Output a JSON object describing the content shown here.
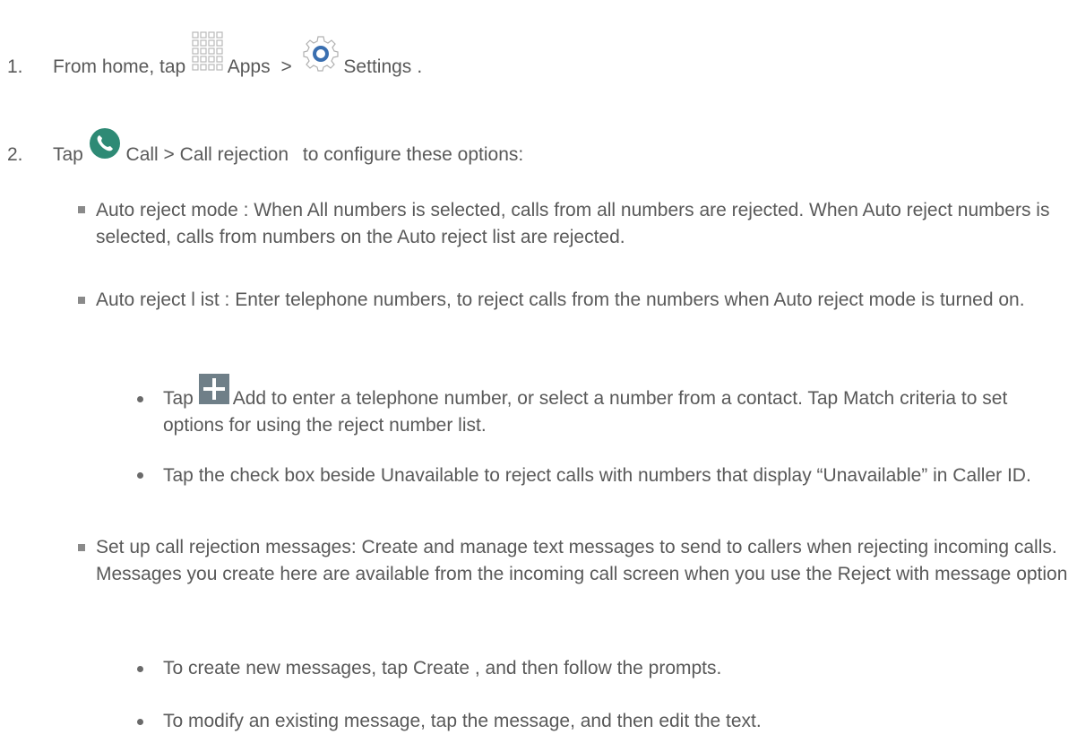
{
  "step1": {
    "number": "1.",
    "text_before": "From home, tap ",
    "apps_label": "Apps",
    "separator": ">",
    "settings_label": "Settings",
    "text_after": "."
  },
  "step2": {
    "number": "2.",
    "text_before": "Tap ",
    "call_label": "Call > Call rejection",
    "text_after": "to configure these options:"
  },
  "bullets": [
    "Auto reject mode  : When All numbers is selected, calls from all numbers are rejected. When Auto reject numbers is selected, calls from numbers on the Auto reject list are rejected.",
    "Auto reject l ist : Enter telephone numbers, to reject calls from the numbers when Auto reject mode is turned on.",
    "Set up call rejection messages: Create and manage text messages to send to callers when rejecting incoming calls. Messages you create here are available from the incoming call screen when you use the Reject with message option"
  ],
  "sub_bullets_list": {
    "add_text_before": "Tap ",
    "add_text_after": "Add  to enter a telephone number, or select a number from a contact. Tap Match criteria to set options for using the reject number list.",
    "unavailable": "Tap the check box beside Unavailable  to reject calls with numbers that display “Unavailable” in Caller ID."
  },
  "sub_bullets_messages": [
    "To create new messages, tap Create , and then follow the prompts.",
    "To modify an existing message, tap the message, and then edit the text."
  ],
  "icons": {
    "apps": "apps-grid-icon",
    "settings": "settings-gear-icon",
    "call": "phone-call-icon",
    "add": "plus-add-icon"
  },
  "colors": {
    "text": "#595959",
    "call_icon": "#2e8a75",
    "settings_icon": "#3a6fb0",
    "add_icon": "#6f7f88"
  }
}
